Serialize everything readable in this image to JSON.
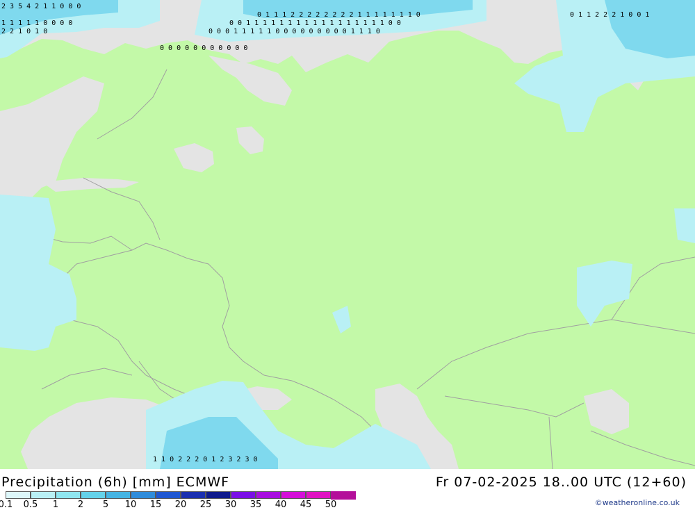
{
  "title": "Precipitation (6h) [mm] ECMWF",
  "datetime": "Fr 07-02-2025 18..00 UTC (12+60)",
  "credit": "©weatheronline.co.uk",
  "colors": {
    "land": "#c3f9a8",
    "sea": "#e4e4e4",
    "border": "#a0a0a0",
    "precip_light": "#b9f0f5",
    "precip_medium": "#7fd9ee"
  },
  "legend": [
    {
      "label": "0.1",
      "color": "#ddf7fa"
    },
    {
      "label": "0.5",
      "color": "#b9f0f5"
    },
    {
      "label": "1",
      "color": "#8fe6f0"
    },
    {
      "label": "2",
      "color": "#64d2ea"
    },
    {
      "label": "5",
      "color": "#45b4e3"
    },
    {
      "label": "10",
      "color": "#2f8cdb"
    },
    {
      "label": "15",
      "color": "#1f57d2"
    },
    {
      "label": "20",
      "color": "#1a2fb0"
    },
    {
      "label": "25",
      "color": "#0f1a8c"
    },
    {
      "label": "30",
      "color": "#7a0fe6"
    },
    {
      "label": "35",
      "color": "#a80ee0"
    },
    {
      "label": "40",
      "color": "#d40fd9"
    },
    {
      "label": "45",
      "color": "#e014c2"
    },
    {
      "label": "50",
      "color": "#b40f9a"
    }
  ],
  "map_values": [
    {
      "row": "2 3 5 4 2 1 1 0 0 0"
    },
    {
      "row": "1 1 1 1 1 0 0 0 0"
    },
    {
      "row": "2 2 1 0 1 0"
    },
    {
      "row": "0 1 1 1 2 2 2 2 2 2 2 2 1 1 1 1 1 1 1 0"
    },
    {
      "row": "0 0 1 1 1 1 1 1 1 1 1 1 1 1 1 1 1 1 1 0 0"
    },
    {
      "row": "0 0 0 1 1 1 1 1 0 0 0 0 0 0 0 0 0 1 1 1 0"
    },
    {
      "row": "0 0 0 0 0 0 0 0 0 0 0"
    },
    {
      "row": "0 1 1 2 2 2 1 0 0 1"
    },
    {
      "row": "1 1 0 2 2 2 0 1 2 3 2 3 0"
    }
  ]
}
